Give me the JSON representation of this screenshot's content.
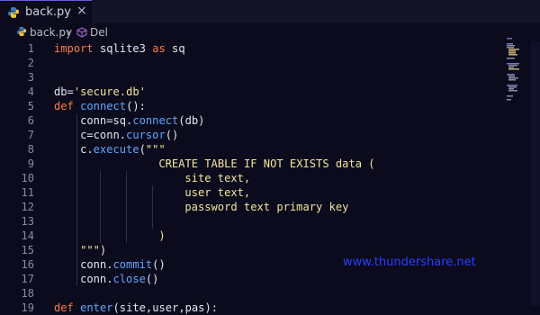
{
  "tab": {
    "title": "back.py",
    "close_glyph": "×"
  },
  "breadcrumb": {
    "file": "back.py",
    "separator": "›",
    "symbol": "Del"
  },
  "editor": {
    "lines": [
      {
        "num": "1",
        "indent": 0,
        "tokens": [
          {
            "t": "import",
            "c": "kw"
          },
          {
            "t": " sqlite3 ",
            "c": ""
          },
          {
            "t": "as",
            "c": "kw"
          },
          {
            "t": " sq",
            "c": ""
          }
        ]
      },
      {
        "num": "2",
        "indent": 0,
        "tokens": []
      },
      {
        "num": "3",
        "indent": 0,
        "tokens": []
      },
      {
        "num": "4",
        "indent": 0,
        "tokens": [
          {
            "t": "db=",
            "c": ""
          },
          {
            "t": "'secure.db'",
            "c": "str"
          }
        ]
      },
      {
        "num": "5",
        "indent": 0,
        "tokens": [
          {
            "t": "def",
            "c": "kw"
          },
          {
            "t": " ",
            "c": ""
          },
          {
            "t": "connect",
            "c": "fn"
          },
          {
            "t": "():",
            "c": ""
          }
        ]
      },
      {
        "num": "6",
        "indent": 4,
        "tokens": [
          {
            "t": "conn=sq.",
            "c": ""
          },
          {
            "t": "connect",
            "c": "fn"
          },
          {
            "t": "(db)",
            "c": ""
          }
        ]
      },
      {
        "num": "7",
        "indent": 4,
        "tokens": [
          {
            "t": "c=conn.",
            "c": ""
          },
          {
            "t": "cursor",
            "c": "fn"
          },
          {
            "t": "()",
            "c": ""
          }
        ]
      },
      {
        "num": "8",
        "indent": 4,
        "tokens": [
          {
            "t": "c.",
            "c": ""
          },
          {
            "t": "execute",
            "c": "fn"
          },
          {
            "t": "(",
            "c": ""
          },
          {
            "t": "\"\"\"",
            "c": "str"
          }
        ]
      },
      {
        "num": "9",
        "indent": 16,
        "tokens": [
          {
            "t": "CREATE TABLE IF NOT EXISTS data (",
            "c": "str"
          }
        ]
      },
      {
        "num": "10",
        "indent": 20,
        "tokens": [
          {
            "t": "site text,",
            "c": "str"
          }
        ]
      },
      {
        "num": "11",
        "indent": 20,
        "tokens": [
          {
            "t": "user text,",
            "c": "str"
          }
        ]
      },
      {
        "num": "12",
        "indent": 20,
        "tokens": [
          {
            "t": "password text primary key",
            "c": "str"
          }
        ]
      },
      {
        "num": "13",
        "indent": 0,
        "tokens": []
      },
      {
        "num": "14",
        "indent": 16,
        "tokens": [
          {
            "t": ")",
            "c": "str"
          }
        ]
      },
      {
        "num": "15",
        "indent": 4,
        "tokens": [
          {
            "t": "\"\"\"",
            "c": "str"
          },
          {
            "t": ")",
            "c": ""
          }
        ]
      },
      {
        "num": "16",
        "indent": 4,
        "tokens": [
          {
            "t": "conn.",
            "c": ""
          },
          {
            "t": "commit",
            "c": "fn"
          },
          {
            "t": "()",
            "c": ""
          }
        ]
      },
      {
        "num": "17",
        "indent": 4,
        "tokens": [
          {
            "t": "conn.",
            "c": ""
          },
          {
            "t": "close",
            "c": "fn"
          },
          {
            "t": "()",
            "c": ""
          }
        ]
      },
      {
        "num": "18",
        "indent": 0,
        "tokens": []
      },
      {
        "num": "19",
        "indent": 0,
        "tokens": [
          {
            "t": "def",
            "c": "kw"
          },
          {
            "t": " ",
            "c": ""
          },
          {
            "t": "enter",
            "c": "fn"
          },
          {
            "t": "(site,user,pas):",
            "c": ""
          }
        ]
      }
    ]
  },
  "watermark": "www.thundershare.net",
  "colors": {
    "background": "#0b0b1d",
    "keyword": "#ff7a3c",
    "function": "#5ea7ff",
    "string": "#f2e69b",
    "watermark": "#2b3fff"
  }
}
